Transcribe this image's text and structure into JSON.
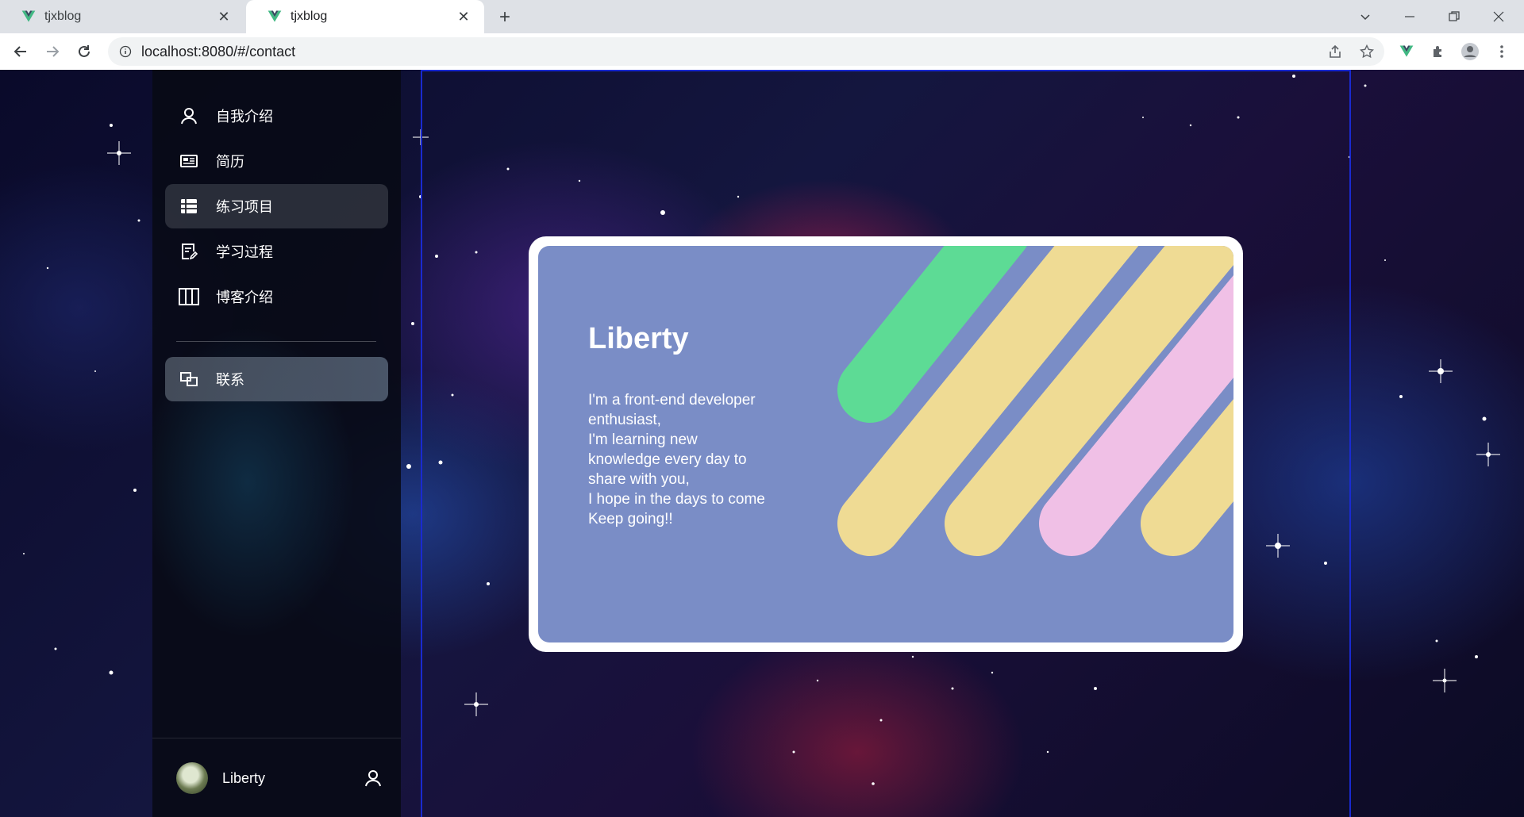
{
  "browser": {
    "tabs": [
      {
        "title": "tjxblog",
        "active": false
      },
      {
        "title": "tjxblog",
        "active": true
      }
    ],
    "url": "localhost:8080/#/contact"
  },
  "sidebar": {
    "items": [
      {
        "label": "自我介绍",
        "icon": "user-icon"
      },
      {
        "label": "简历",
        "icon": "resume-icon"
      },
      {
        "label": "练习项目",
        "icon": "list-icon"
      },
      {
        "label": "学习过程",
        "icon": "edit-note-icon"
      },
      {
        "label": "博客介绍",
        "icon": "columns-icon"
      },
      {
        "label": "联系",
        "icon": "contact-icon"
      }
    ],
    "user": {
      "name": "Liberty"
    }
  },
  "card": {
    "name": "Liberty",
    "lines": [
      "I'm a front-end developer",
      "enthusiast,",
      "I'm learning new",
      "knowledge every day to",
      "share with you,",
      "I hope in the days to come",
      "Keep going!!"
    ]
  },
  "colors": {
    "card_bg": "#7a8dc6",
    "stripe_green": "#5ddb95",
    "stripe_yellow": "#efdb94",
    "stripe_pink": "#f0c0e6"
  }
}
